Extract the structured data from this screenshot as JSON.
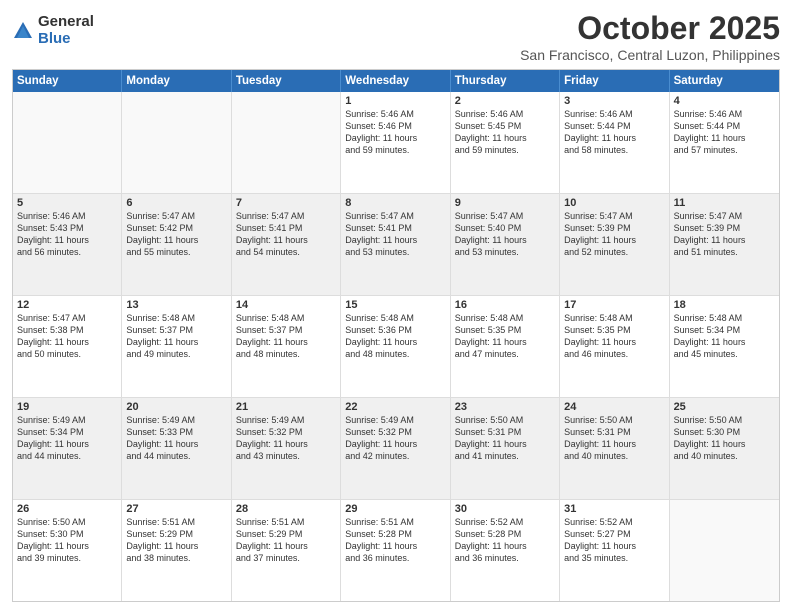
{
  "logo": {
    "general": "General",
    "blue": "Blue"
  },
  "header": {
    "month": "October 2025",
    "location": "San Francisco, Central Luzon, Philippines"
  },
  "weekdays": [
    "Sunday",
    "Monday",
    "Tuesday",
    "Wednesday",
    "Thursday",
    "Friday",
    "Saturday"
  ],
  "rows": [
    [
      {
        "day": "",
        "info": ""
      },
      {
        "day": "",
        "info": ""
      },
      {
        "day": "",
        "info": ""
      },
      {
        "day": "1",
        "info": "Sunrise: 5:46 AM\nSunset: 5:46 PM\nDaylight: 11 hours\nand 59 minutes."
      },
      {
        "day": "2",
        "info": "Sunrise: 5:46 AM\nSunset: 5:45 PM\nDaylight: 11 hours\nand 59 minutes."
      },
      {
        "day": "3",
        "info": "Sunrise: 5:46 AM\nSunset: 5:44 PM\nDaylight: 11 hours\nand 58 minutes."
      },
      {
        "day": "4",
        "info": "Sunrise: 5:46 AM\nSunset: 5:44 PM\nDaylight: 11 hours\nand 57 minutes."
      }
    ],
    [
      {
        "day": "5",
        "info": "Sunrise: 5:46 AM\nSunset: 5:43 PM\nDaylight: 11 hours\nand 56 minutes."
      },
      {
        "day": "6",
        "info": "Sunrise: 5:47 AM\nSunset: 5:42 PM\nDaylight: 11 hours\nand 55 minutes."
      },
      {
        "day": "7",
        "info": "Sunrise: 5:47 AM\nSunset: 5:41 PM\nDaylight: 11 hours\nand 54 minutes."
      },
      {
        "day": "8",
        "info": "Sunrise: 5:47 AM\nSunset: 5:41 PM\nDaylight: 11 hours\nand 53 minutes."
      },
      {
        "day": "9",
        "info": "Sunrise: 5:47 AM\nSunset: 5:40 PM\nDaylight: 11 hours\nand 53 minutes."
      },
      {
        "day": "10",
        "info": "Sunrise: 5:47 AM\nSunset: 5:39 PM\nDaylight: 11 hours\nand 52 minutes."
      },
      {
        "day": "11",
        "info": "Sunrise: 5:47 AM\nSunset: 5:39 PM\nDaylight: 11 hours\nand 51 minutes."
      }
    ],
    [
      {
        "day": "12",
        "info": "Sunrise: 5:47 AM\nSunset: 5:38 PM\nDaylight: 11 hours\nand 50 minutes."
      },
      {
        "day": "13",
        "info": "Sunrise: 5:48 AM\nSunset: 5:37 PM\nDaylight: 11 hours\nand 49 minutes."
      },
      {
        "day": "14",
        "info": "Sunrise: 5:48 AM\nSunset: 5:37 PM\nDaylight: 11 hours\nand 48 minutes."
      },
      {
        "day": "15",
        "info": "Sunrise: 5:48 AM\nSunset: 5:36 PM\nDaylight: 11 hours\nand 48 minutes."
      },
      {
        "day": "16",
        "info": "Sunrise: 5:48 AM\nSunset: 5:35 PM\nDaylight: 11 hours\nand 47 minutes."
      },
      {
        "day": "17",
        "info": "Sunrise: 5:48 AM\nSunset: 5:35 PM\nDaylight: 11 hours\nand 46 minutes."
      },
      {
        "day": "18",
        "info": "Sunrise: 5:48 AM\nSunset: 5:34 PM\nDaylight: 11 hours\nand 45 minutes."
      }
    ],
    [
      {
        "day": "19",
        "info": "Sunrise: 5:49 AM\nSunset: 5:34 PM\nDaylight: 11 hours\nand 44 minutes."
      },
      {
        "day": "20",
        "info": "Sunrise: 5:49 AM\nSunset: 5:33 PM\nDaylight: 11 hours\nand 44 minutes."
      },
      {
        "day": "21",
        "info": "Sunrise: 5:49 AM\nSunset: 5:32 PM\nDaylight: 11 hours\nand 43 minutes."
      },
      {
        "day": "22",
        "info": "Sunrise: 5:49 AM\nSunset: 5:32 PM\nDaylight: 11 hours\nand 42 minutes."
      },
      {
        "day": "23",
        "info": "Sunrise: 5:50 AM\nSunset: 5:31 PM\nDaylight: 11 hours\nand 41 minutes."
      },
      {
        "day": "24",
        "info": "Sunrise: 5:50 AM\nSunset: 5:31 PM\nDaylight: 11 hours\nand 40 minutes."
      },
      {
        "day": "25",
        "info": "Sunrise: 5:50 AM\nSunset: 5:30 PM\nDaylight: 11 hours\nand 40 minutes."
      }
    ],
    [
      {
        "day": "26",
        "info": "Sunrise: 5:50 AM\nSunset: 5:30 PM\nDaylight: 11 hours\nand 39 minutes."
      },
      {
        "day": "27",
        "info": "Sunrise: 5:51 AM\nSunset: 5:29 PM\nDaylight: 11 hours\nand 38 minutes."
      },
      {
        "day": "28",
        "info": "Sunrise: 5:51 AM\nSunset: 5:29 PM\nDaylight: 11 hours\nand 37 minutes."
      },
      {
        "day": "29",
        "info": "Sunrise: 5:51 AM\nSunset: 5:28 PM\nDaylight: 11 hours\nand 36 minutes."
      },
      {
        "day": "30",
        "info": "Sunrise: 5:52 AM\nSunset: 5:28 PM\nDaylight: 11 hours\nand 36 minutes."
      },
      {
        "day": "31",
        "info": "Sunrise: 5:52 AM\nSunset: 5:27 PM\nDaylight: 11 hours\nand 35 minutes."
      },
      {
        "day": "",
        "info": ""
      }
    ]
  ]
}
